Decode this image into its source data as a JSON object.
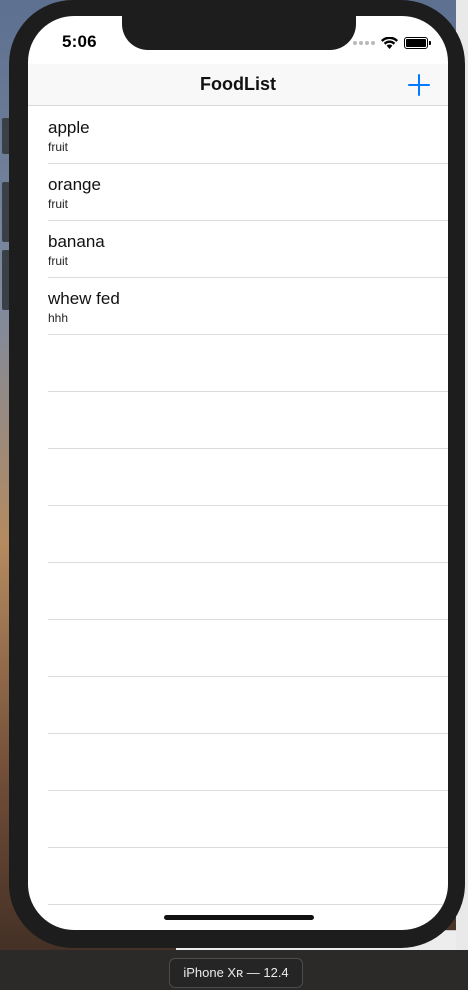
{
  "status_bar": {
    "time": "5:06"
  },
  "navbar": {
    "title": "FoodList",
    "add_icon": "plus-icon",
    "accent_color": "#007aff"
  },
  "foods": [
    {
      "name": "apple",
      "category": "fruit"
    },
    {
      "name": "orange",
      "category": "fruit"
    },
    {
      "name": "banana",
      "category": "fruit"
    },
    {
      "name": "whew fed",
      "category": "hhh"
    }
  ],
  "empty_row_count": 10,
  "simulator": {
    "device_label": "iPhone Xʀ — 12.4"
  }
}
